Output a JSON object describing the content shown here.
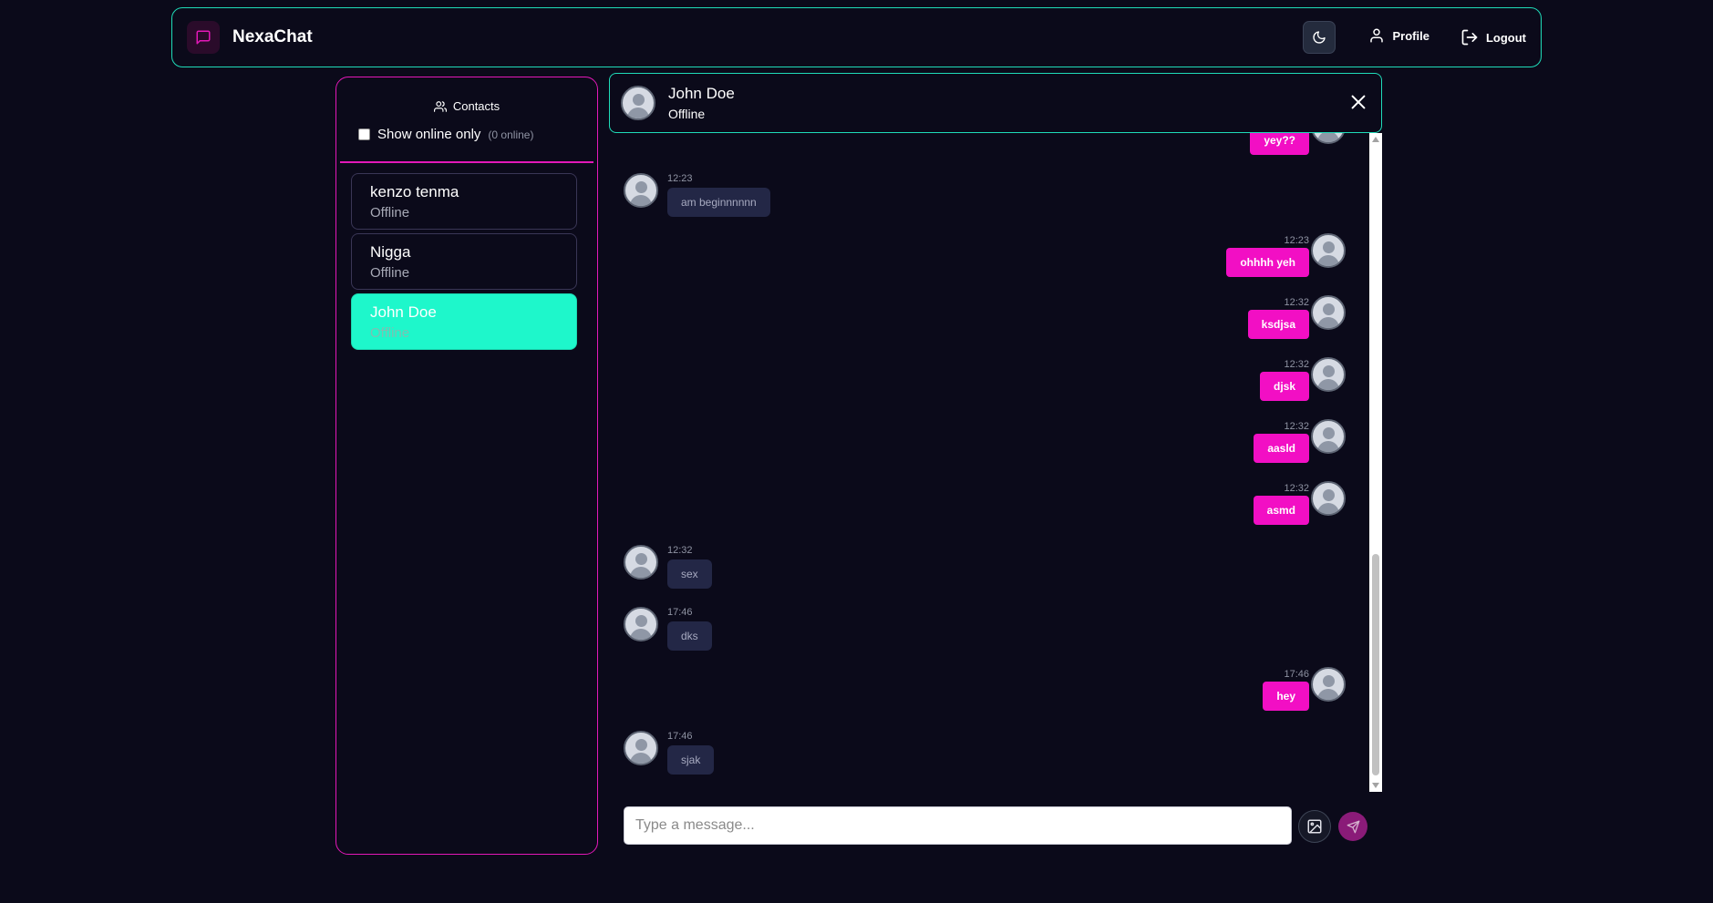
{
  "app": {
    "name": "NexaChat"
  },
  "nav": {
    "profile_label": "Profile",
    "logout_label": "Logout"
  },
  "sidebar": {
    "title": "Contacts",
    "filter_label": "Show online only",
    "online_count": "(0 online)",
    "contacts": [
      {
        "name": "kenzo tenma",
        "status": "Offline",
        "active": false
      },
      {
        "name": "Nigga",
        "status": "Offline",
        "active": false
      },
      {
        "name": "John Doe",
        "status": "Offline",
        "active": true
      }
    ]
  },
  "chat": {
    "contact_name": "John Doe",
    "contact_status": "Offline",
    "messages": [
      {
        "dir": "out",
        "time": "",
        "text": "yey??"
      },
      {
        "dir": "in",
        "time": "12:23",
        "text": "am beginnnnnn"
      },
      {
        "dir": "out",
        "time": "12:23",
        "text": "ohhhh yeh"
      },
      {
        "dir": "out",
        "time": "12:32",
        "text": "ksdjsa"
      },
      {
        "dir": "out",
        "time": "12:32",
        "text": "djsk"
      },
      {
        "dir": "out",
        "time": "12:32",
        "text": "aasld"
      },
      {
        "dir": "out",
        "time": "12:32",
        "text": "asmd"
      },
      {
        "dir": "in",
        "time": "12:32",
        "text": "sex"
      },
      {
        "dir": "in",
        "time": "17:46",
        "text": "dks"
      },
      {
        "dir": "out",
        "time": "17:46",
        "text": "hey"
      },
      {
        "dir": "in",
        "time": "17:46",
        "text": "sjak"
      }
    ]
  },
  "composer": {
    "placeholder": "Type a message..."
  },
  "colors": {
    "accent_teal": "#1fdcb9",
    "accent_pink": "#f20fc4",
    "background": "#0b0a1a"
  },
  "icons": [
    "chat-bubble-icon",
    "moon-icon",
    "user-icon",
    "logout-icon",
    "users-icon",
    "close-icon",
    "image-icon",
    "send-icon"
  ]
}
